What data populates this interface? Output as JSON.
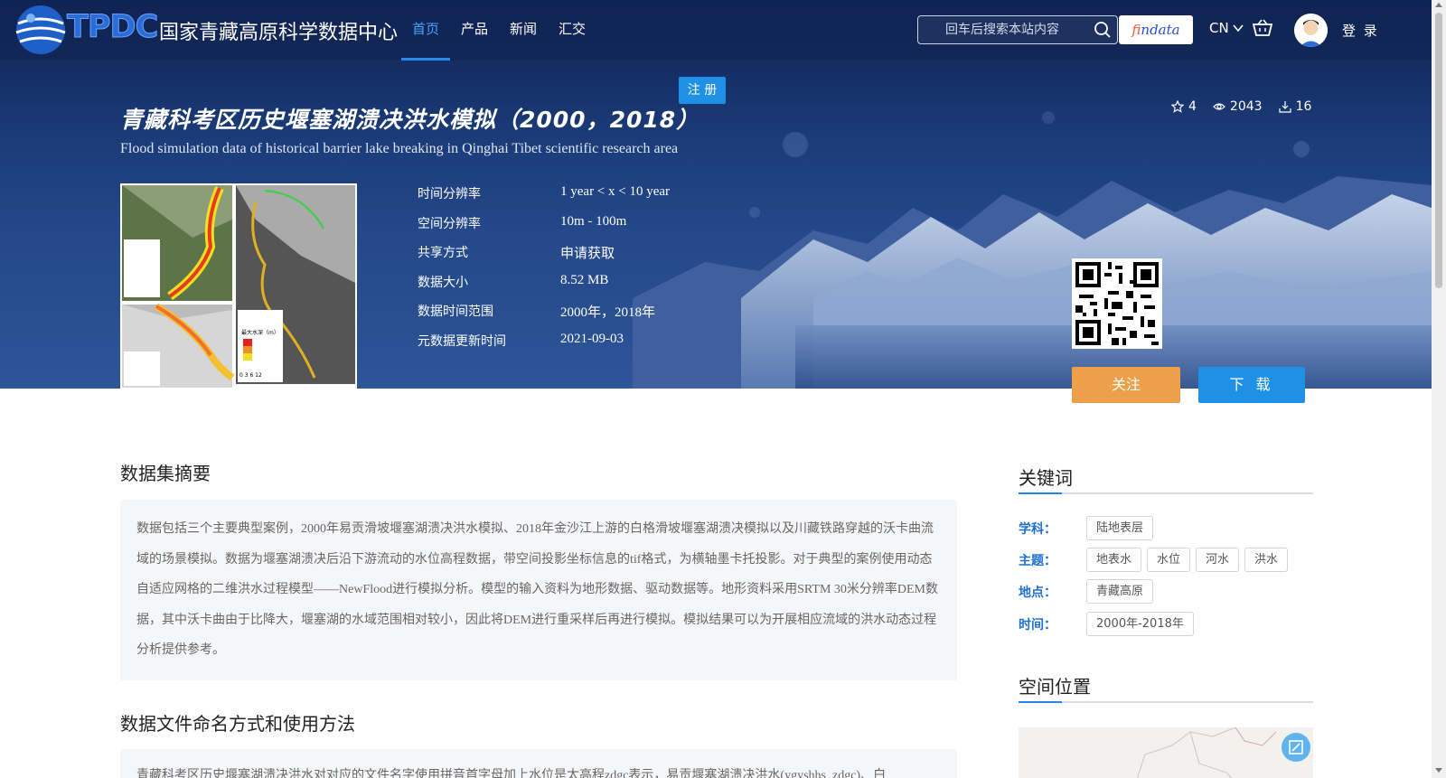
{
  "brand": {
    "logo_letters": "TPDC",
    "name": "国家青藏高原科学数据中心"
  },
  "nav": {
    "items": [
      {
        "label": "首页",
        "active": true
      },
      {
        "label": "产品",
        "active": false
      },
      {
        "label": "新闻",
        "active": false
      },
      {
        "label": "汇交",
        "active": false
      }
    ]
  },
  "search": {
    "placeholder": "回车后搜索本站内容",
    "icon": "search-icon"
  },
  "findata": {
    "first": "f",
    "rest": "indata"
  },
  "lang": "CN",
  "login": "登 录",
  "register": "注 册",
  "dataset": {
    "title_zh": "青藏科考区历史堰塞湖溃决洪水模拟（2000，2018）",
    "title_en": "Flood simulation data of historical barrier lake breaking in Qinghai Tibet scientific research area",
    "stats": {
      "stars": "4",
      "views": "2043",
      "downloads": "16"
    },
    "meta": [
      {
        "key": "时间分辨率",
        "value": "1 year < x < 10 year"
      },
      {
        "key": "空间分辨率",
        "value": "10m - 100m"
      },
      {
        "key": "共享方式",
        "value": "申请获取"
      },
      {
        "key": "数据大小",
        "value": "8.52 MB"
      },
      {
        "key": "数据时间范围",
        "value": "2000年，2018年"
      },
      {
        "key": "元数据更新时间",
        "value": "2021-09-03"
      }
    ]
  },
  "buttons": {
    "follow": "关注",
    "download": "下 载"
  },
  "abstract": {
    "title": "数据集摘要",
    "text": "数据包括三个主要典型案例，2000年易贡滑坡堰塞湖溃决洪水模拟、2018年金沙江上游的白格滑坡堰塞湖溃决模拟以及川藏铁路穿越的沃卡曲流域的场景模拟。数据为堰塞湖溃决后沿下游流动的水位高程数据，带空间投影坐标信息的tif格式，为横轴墨卡托投影。对于典型的案例使用动态自适应网格的二维洪水过程模型——NewFlood进行模拟分析。模型的输入资料为地形数据、驱动数据等。地形资料采用SRTM 30米分辨率DEM数据，其中沃卡曲由于比降大，堰塞湖的水域范围相对较小，因此将DEM进行重采样后再进行模拟。模拟结果可以为开展相应流域的洪水动态过程分析提供参考。"
  },
  "file_naming": {
    "title": "数据文件命名方式和使用方法",
    "text": "青藏科考区历史堰塞湖溃决洪水对对应的文件名字使用拼音首字母加上水位是太高程zdgc表示，易贡堰塞湖溃决洪水(ygyshhs_zdgc)、白"
  },
  "keywords": {
    "title": "关键词",
    "rows": [
      {
        "label": "学科：",
        "tags": [
          "陆地表层"
        ]
      },
      {
        "label": "主题：",
        "tags": [
          "地表水",
          "水位",
          "河水",
          "洪水"
        ]
      },
      {
        "label": "地点：",
        "tags": [
          "青藏高原"
        ]
      },
      {
        "label": "时间：",
        "tags": [
          "2000年-2018年"
        ]
      }
    ]
  },
  "location": {
    "title": "空间位置"
  },
  "thumbnail": {
    "legend_label": "最大水深（m）",
    "scale": "0 3 6 12"
  }
}
